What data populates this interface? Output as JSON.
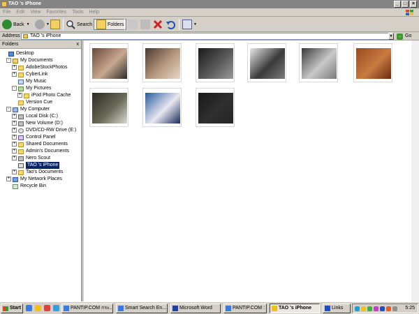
{
  "window": {
    "title": "TAO 's iPhone"
  },
  "menu": [
    "File",
    "Edit",
    "View",
    "Favorites",
    "Tools",
    "Help"
  ],
  "toolbar": {
    "back_label": "Back",
    "search_label": "Search",
    "folders_label": "Folders"
  },
  "address": {
    "label": "Address",
    "value": "TAO 's iPhone",
    "go_label": "Go"
  },
  "folders_pane": {
    "title": "Folders",
    "close_glyph": "x",
    "items": [
      {
        "label": "Desktop",
        "icon": "desktop-icon",
        "expander": "",
        "selected": false
      },
      {
        "label": "My Documents",
        "icon": "my-documents-icon",
        "expander": "-",
        "selected": false
      },
      {
        "label": "AdobeStockPhotos",
        "icon": "folder-icon",
        "expander": "+",
        "selected": false
      },
      {
        "label": "CyberLink",
        "icon": "folder-icon",
        "expander": "+",
        "selected": false
      },
      {
        "label": "My Music",
        "icon": "music-folder-icon",
        "expander": "",
        "selected": false
      },
      {
        "label": "My Pictures",
        "icon": "pictures-folder-icon",
        "expander": "-",
        "selected": false
      },
      {
        "label": "iPod Photo Cache",
        "icon": "folder-icon",
        "expander": "+",
        "selected": false
      },
      {
        "label": "Version Cue",
        "icon": "folder-icon",
        "expander": "",
        "selected": false
      },
      {
        "label": "My Computer",
        "icon": "computer-icon",
        "expander": "-",
        "selected": false
      },
      {
        "label": "Local Disk (C:)",
        "icon": "drive-icon",
        "expander": "+",
        "selected": false
      },
      {
        "label": "New Volume (D:)",
        "icon": "drive-icon",
        "expander": "+",
        "selected": false
      },
      {
        "label": "DVD/CD-RW Drive (E:)",
        "icon": "cd-drive-icon",
        "expander": "+",
        "selected": false
      },
      {
        "label": "Control Panel",
        "icon": "control-panel-icon",
        "expander": "+",
        "selected": false
      },
      {
        "label": "Shared Documents",
        "icon": "folder-icon",
        "expander": "+",
        "selected": false
      },
      {
        "label": "Admin's Documents",
        "icon": "folder-icon",
        "expander": "+",
        "selected": false
      },
      {
        "label": "Nero Scout",
        "icon": "nero-scout-icon",
        "expander": "+",
        "selected": false
      },
      {
        "label": "TAO 's iPhone",
        "icon": "phone-icon",
        "expander": "",
        "selected": true
      },
      {
        "label": "Tao's Documents",
        "icon": "folder-icon",
        "expander": "+",
        "selected": false
      },
      {
        "label": "My Network Places",
        "icon": "network-icon",
        "expander": "+",
        "selected": false
      },
      {
        "label": "Recycle Bin",
        "icon": "recycle-bin-icon",
        "expander": "",
        "selected": false
      }
    ]
  },
  "thumbnails": [
    {
      "name": "photo-thumb-1",
      "colors": [
        "#6a4a3a",
        "#c8a890",
        "#2a2a2a"
      ]
    },
    {
      "name": "photo-thumb-2",
      "colors": [
        "#4a3a30",
        "#b89a80",
        "#e8d8c8"
      ]
    },
    {
      "name": "photo-thumb-3",
      "colors": [
        "#1a1a1a",
        "#5a5a5a",
        "#9a9a9a"
      ]
    },
    {
      "name": "photo-thumb-4",
      "colors": [
        "#e8e8e8",
        "#3a3a3a",
        "#7a7a7a"
      ]
    },
    {
      "name": "photo-thumb-5",
      "colors": [
        "#3a3a3a",
        "#c8c8c8",
        "#7a7a7a"
      ]
    },
    {
      "name": "photo-thumb-6",
      "colors": [
        "#9a4a20",
        "#c87a40",
        "#6a2a10"
      ]
    },
    {
      "name": "photo-thumb-7",
      "colors": [
        "#2a2a20",
        "#6a6a58",
        "#d8d8d0"
      ]
    },
    {
      "name": "photo-thumb-8",
      "colors": [
        "#2a5aa0",
        "#e8e8f0",
        "#1a2a5a"
      ]
    },
    {
      "name": "photo-thumb-9",
      "colors": [
        "#181818",
        "#303030",
        "#242424"
      ]
    }
  ],
  "taskbar": {
    "start_label": "Start",
    "tasks": [
      {
        "label": "PANTIP.COM กระ...",
        "active": false
      },
      {
        "label": "Smart Search En...",
        "active": false
      },
      {
        "label": "Microsoft Word",
        "active": false
      },
      {
        "label": "PANTIP.COM : T...",
        "active": false
      },
      {
        "label": "TAO 's iPhone",
        "active": true
      }
    ],
    "links_label": "Links",
    "clock": "5:25"
  }
}
